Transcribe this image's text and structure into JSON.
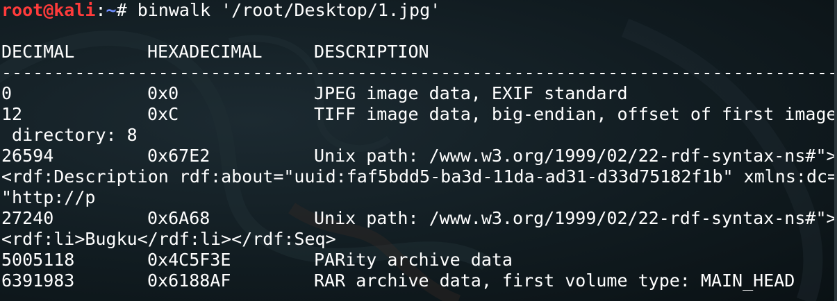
{
  "prompt": {
    "user_host": "root@kali",
    "separator": ":",
    "path": "~",
    "symbol": "#",
    "command": " binwalk '/root/Desktop/1.jpg'"
  },
  "headers": [
    "DECIMAL",
    "HEXADECIMAL",
    "DESCRIPTION"
  ],
  "divider": "--------------------------------------------------------------------------------------------------------------------------------------------------------------------------------",
  "rows": [
    {
      "decimal": "0",
      "hex": "0x0",
      "description": "JPEG image data, EXIF standard"
    },
    {
      "decimal": "12",
      "hex": "0xC",
      "description": "TIFF image data, big-endian, offset of first image"
    },
    {
      "continuation": " directory: 8"
    },
    {
      "decimal": "26594",
      "hex": "0x67E2",
      "description": "Unix path: /www.w3.org/1999/02/22-rdf-syntax-ns#\">"
    },
    {
      "continuation": "<rdf:Description rdf:about=\"uuid:faf5bdd5-ba3d-11da-ad31-d33d75182f1b\" xmlns:dc="
    },
    {
      "continuation": "\"http://p"
    },
    {
      "decimal": "27240",
      "hex": "0x6A68",
      "description": "Unix path: /www.w3.org/1999/02/22-rdf-syntax-ns#\">"
    },
    {
      "continuation": "<rdf:li>Bugku</rdf:li></rdf:Seq>"
    },
    {
      "decimal": "5005118",
      "hex": "0x4C5F3E",
      "description": "PARity archive data"
    },
    {
      "decimal": "6391983",
      "hex": "0x6188AF",
      "description": "RAR archive data, first volume type: MAIN_HEAD"
    }
  ],
  "colors": {
    "background": "#0d1519",
    "text": "#ffffff",
    "prompt_user": "#ff3b3b",
    "prompt_path": "#6f8fff"
  }
}
